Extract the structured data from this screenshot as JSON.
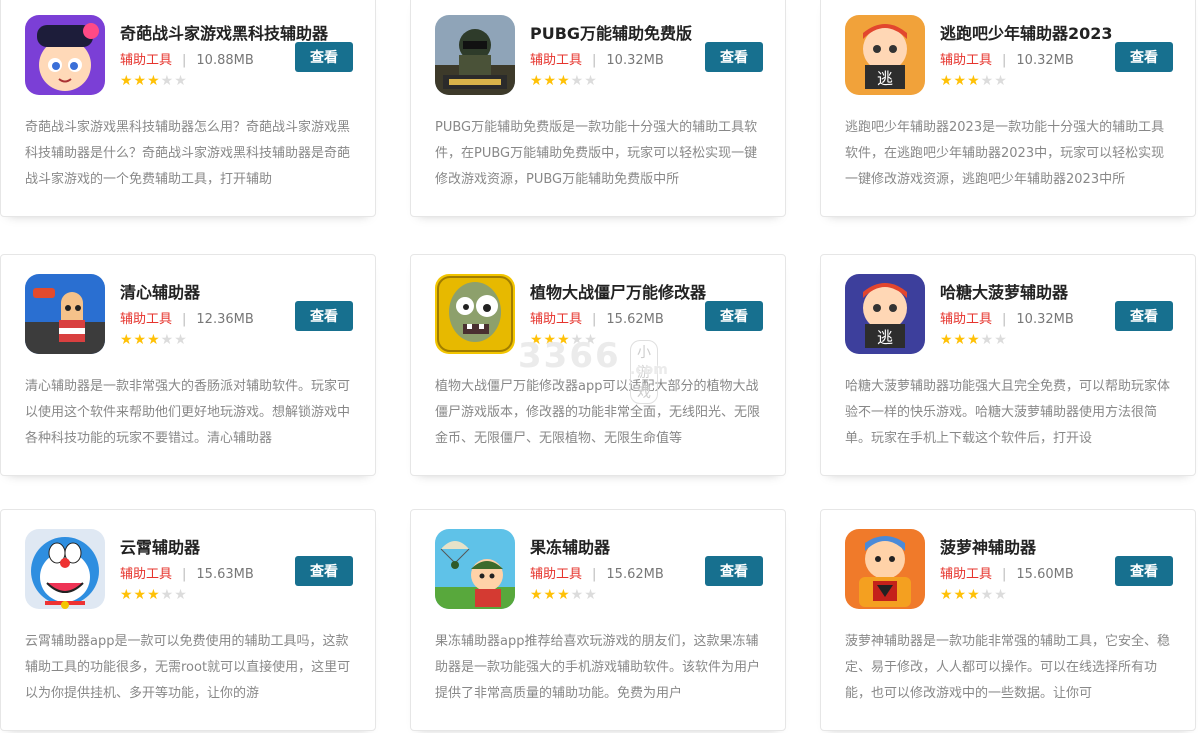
{
  "apps": [
    {
      "title": "奇葩战斗家游戏黑科技辅助器",
      "category": "辅助工具",
      "size": "10.88MB",
      "rating": 3,
      "button": "查看",
      "desc": "奇葩战斗家游戏黑科技辅助器怎么用？奇葩战斗家游戏黑科技辅助器是什么？奇葩战斗家游戏黑科技辅助器是奇葩战斗家游戏的一个免费辅助工具，打开辅助",
      "icon": "cartoon-kid-icon"
    },
    {
      "title": "PUBG万能辅助免费版",
      "category": "辅助工具",
      "size": "10.32MB",
      "rating": 3,
      "button": "查看",
      "desc": "PUBG万能辅助免费版是一款功能十分强大的辅助工具软件，在PUBG万能辅助免费版中，玩家可以轻松实现一键修改游戏资源，PUBG万能辅助免费版中所",
      "icon": "pubg-soldier-icon"
    },
    {
      "title": "逃跑吧少年辅助器2023",
      "category": "辅助工具",
      "size": "10.32MB",
      "rating": 3,
      "button": "查看",
      "desc": "逃跑吧少年辅助器2023是一款功能十分强大的辅助工具软件，在逃跑吧少年辅助器2023中，玩家可以轻松实现一键修改游戏资源，逃跑吧少年辅助器2023中所",
      "icon": "escape-boy-icon"
    },
    {
      "title": "清心辅助器",
      "category": "辅助工具",
      "size": "12.36MB",
      "rating": 3,
      "button": "查看",
      "desc": "清心辅助器是一款非常强大的香肠派对辅助软件。玩家可以使用这个软件来帮助他们更好地玩游戏。想解锁游戏中各种科技功能的玩家不要错过。清心辅助器",
      "icon": "sausage-man-icon"
    },
    {
      "title": "植物大战僵尸万能修改器",
      "category": "辅助工具",
      "size": "15.62MB",
      "rating": 3,
      "button": "查看",
      "desc": "植物大战僵尸万能修改器app可以适配大部分的植物大战僵尸游戏版本，修改器的功能非常全面，无线阳光、无限金币、无限僵尸、无限植物、无限生命值等",
      "icon": "zombie-icon"
    },
    {
      "title": "哈糖大菠萝辅助器",
      "category": "辅助工具",
      "size": "10.32MB",
      "rating": 3,
      "button": "查看",
      "desc": "哈糖大菠萝辅助器功能强大且完全免费，可以帮助玩家体验不一样的快乐游戏。哈糖大菠萝辅助器使用方法很简单。玩家在手机上下载这个软件后，打开设",
      "icon": "escape-boy-icon"
    },
    {
      "title": "云霄辅助器",
      "category": "辅助工具",
      "size": "15.63MB",
      "rating": 3,
      "button": "查看",
      "desc": "云霄辅助器app是一款可以免费使用的辅助工具吗，这款辅助工具的功能很多，无需root就可以直接使用，这里可以为你提供挂机、多开等功能，让你的游",
      "icon": "doraemon-icon"
    },
    {
      "title": "果冻辅助器",
      "category": "辅助工具",
      "size": "15.62MB",
      "rating": 3,
      "button": "查看",
      "desc": "果冻辅助器app推荐给喜欢玩游戏的朋友们，这款果冻辅助器是一款功能强大的手机游戏辅助软件。该软件为用户提供了非常高质量的辅助功能。免费为用户",
      "icon": "parachute-soldier-icon"
    },
    {
      "title": "菠萝神辅助器",
      "category": "辅助工具",
      "size": "15.60MB",
      "rating": 3,
      "button": "查看",
      "desc": "菠萝神辅助器是一款功能非常强的辅助工具，它安全、稳定、易于修改，人人都可以操作。可以在线选择所有功能，也可以修改游戏中的一些数据。让你可",
      "icon": "transformer-boy-icon"
    }
  ],
  "watermark": {
    "text": "3366",
    "sub": "小游戏",
    "domain": ".com"
  }
}
